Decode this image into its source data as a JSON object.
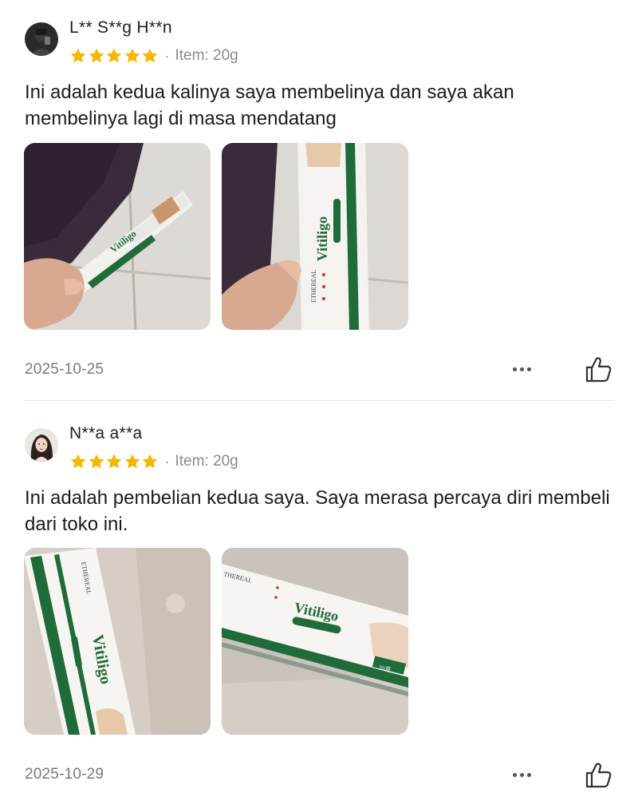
{
  "reviews": [
    {
      "username": "L** S**g H**n",
      "rating": 5,
      "separator": "·",
      "item": "Item: 20g",
      "text": "Ini adalah kedua kalinya saya membelinya dan saya akan membelinya lagi di masa mendatang",
      "photos": [
        "photo-tube-held",
        "photo-box-held"
      ],
      "date": "2025-10-25"
    },
    {
      "username": "N**a a**a",
      "rating": 5,
      "separator": "·",
      "item": "Item: 20g",
      "text": "Ini adalah pembelian kedua saya. Saya merasa percaya diri membeli dari toko ini.",
      "photos": [
        "photo-box-vertical",
        "photo-box-horizontal"
      ],
      "date": "2025-10-29"
    }
  ],
  "colors": {
    "star": "#f5b800",
    "text_muted": "#8a8a8a",
    "product_green": "#1f6b3a"
  },
  "icons": [
    "avatar",
    "star-icon",
    "more-icon",
    "thumbs-up-icon"
  ]
}
